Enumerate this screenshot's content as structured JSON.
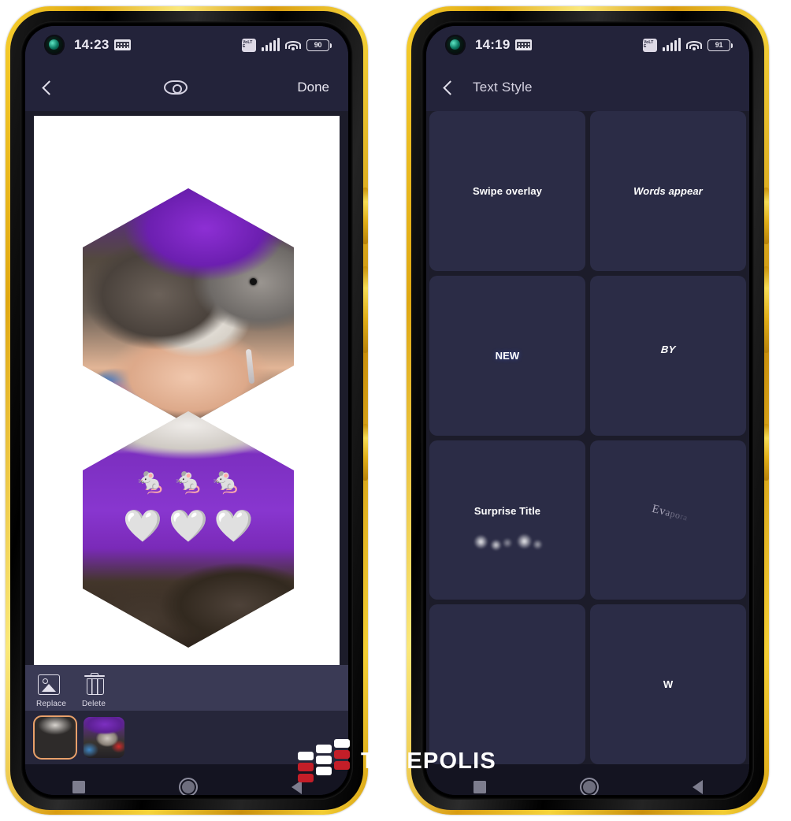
{
  "left_phone": {
    "status_bar": {
      "time": "14:23",
      "battery_level": "90",
      "icons": [
        "punch-hole-camera",
        "keyboard-icon",
        "volte-icon",
        "signal-bars-icon",
        "wifi-icon",
        "battery-icon"
      ]
    },
    "app_bar": {
      "back_icon": "chevron-left-icon",
      "preview_icon": "eye-icon",
      "done_label": "Done"
    },
    "canvas": {
      "hex_top_alt": "rat held in hand over purple blanket",
      "hex_bottom_alt": "rats on purple blanket",
      "emoji_mice": [
        "🐁",
        "🐁",
        "🐁"
      ],
      "emoji_hearts": [
        "🤍",
        "🤍",
        "🤍"
      ]
    },
    "tools": [
      {
        "label": "Replace",
        "icon": "image-icon"
      },
      {
        "label": "Delete",
        "icon": "trash-icon"
      }
    ],
    "filmstrip": [
      {
        "name": "clip-1",
        "selected": true
      },
      {
        "name": "clip-2",
        "selected": false
      }
    ],
    "nav_bar": [
      "recents-square-icon",
      "home-circle-icon",
      "back-triangle-icon"
    ]
  },
  "right_phone": {
    "status_bar": {
      "time": "14:19",
      "battery_level": "91",
      "icons": [
        "punch-hole-camera",
        "keyboard-icon",
        "volte-icon",
        "signal-bars-icon",
        "wifi-icon",
        "battery-icon"
      ]
    },
    "app_bar": {
      "back_icon": "chevron-left-icon",
      "title": "Text Style"
    },
    "styles": [
      {
        "label": "Swipe overlay",
        "style": "plain-white"
      },
      {
        "label": "Words appear",
        "style": "purple-italic"
      },
      {
        "label": "NEW",
        "style": "blue-bold-glow"
      },
      {
        "label": "BY",
        "style": "white-italic-skew"
      },
      {
        "label": "Surprise Title",
        "style": "smoke-reveal"
      },
      {
        "label": "Evapora",
        "style": "evaporate-rotate"
      },
      {
        "label": "",
        "style": "empty"
      },
      {
        "label": "W",
        "style": "faint-w"
      }
    ],
    "nav_bar": [
      "recents-square-icon",
      "home-circle-icon",
      "back-triangle-icon"
    ]
  },
  "watermark": {
    "text": "TELEPOLIS",
    "logo_colors": [
      "#ffffff",
      "#c41e28"
    ]
  },
  "colors": {
    "frame_gold": "#e8b71c",
    "screen_bg": "#1c1c2a",
    "bar_bg": "#23233a",
    "cell_bg": "#2b2c46",
    "accent_purple": "#7a3df0",
    "accent_blue": "#3a5bf5",
    "selection_orange": "#e8a06a"
  }
}
